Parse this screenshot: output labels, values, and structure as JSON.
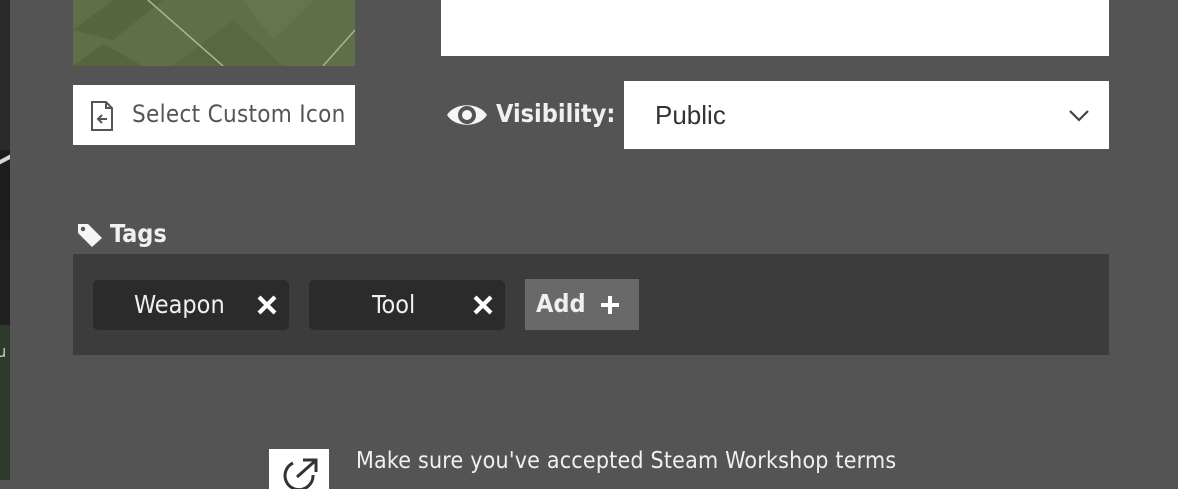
{
  "custom_icon": {
    "label": "Select Custom Icon",
    "icon": "file-import-icon"
  },
  "visibility": {
    "label": "Visibility:",
    "icon": "eye-icon",
    "selected": "Public",
    "chevron": "chevron-down-icon"
  },
  "tags": {
    "label": "Tags",
    "icon": "tag-icon",
    "items": [
      {
        "label": "Weapon"
      },
      {
        "label": "Tool"
      }
    ],
    "add_label": "Add"
  },
  "footer": {
    "terms_text": "Make sure you've accepted Steam Workshop terms",
    "link_icon": "external-link-icon"
  }
}
